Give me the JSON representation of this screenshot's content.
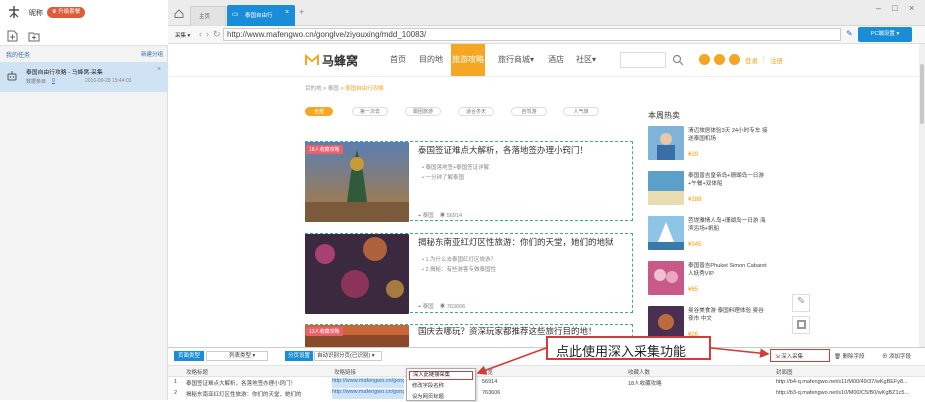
{
  "app": {
    "username": "昵称",
    "upgrade": "升级套餐",
    "my_tasks": "我的任务",
    "create_group": "新建分组",
    "task": {
      "title": "泰国自由行攻略 - 马蜂窝-采集",
      "count_label": "数据条目",
      "count": "0",
      "time": "2016-09-28 15:44:03"
    }
  },
  "browser": {
    "tabs": [
      {
        "label": "主页"
      },
      {
        "label": "泰国自由行"
      }
    ],
    "new_tab": "+",
    "collect_mode": "采集",
    "url": "http://www.mafengwo.cn/gonglve/ziyouxing/mdd_10083/",
    "pc_button": "PC端设置"
  },
  "site": {
    "logo": "马蜂窝",
    "nav": [
      "首页",
      "目的地",
      "旅游攻略",
      "旅行商城",
      "酒店",
      "社区"
    ],
    "login": "登录",
    "register": "注册",
    "breadcrumb": [
      "目的地",
      "泰国",
      "泰国自由行攻略"
    ],
    "filters": [
      "全部",
      "第一次去",
      "跟团旅游",
      "适合冬天",
      "自驾游",
      "人气旅"
    ],
    "articles": [
      {
        "title": "泰国签证难点大解析，各落地签办理小窍门！",
        "badge": "18人收藏攻略",
        "bullets": [
          "泰国落地签+泰国签证详解",
          "一分钟了解泰国"
        ],
        "place": "泰国",
        "views": "56914"
      },
      {
        "title": "揭秘东南亚红灯区性旅游：你们的天堂，她们的地狱",
        "badge": "",
        "bullets": [
          "1.为什么去泰国红灯区旅游？",
          "2.揭秘：有些游客专做泰国性"
        ],
        "place": "泰国",
        "views": "763606"
      },
      {
        "title": "国庆去哪玩？资深玩家都推荐这些旅行目的地！",
        "badge": "13人收藏攻略",
        "bullets": [],
        "place": "",
        "views": ""
      }
    ],
    "hot_title": "本周热卖",
    "hot": [
      {
        "text": "清迈旅居体验3天 24小时专车 接送泰国机场",
        "price": "¥39"
      },
      {
        "text": "泰国普吉皇帝岛+珊瑚岛一日游+午餐+双体船",
        "price": "¥288"
      },
      {
        "text": "芭堤雅情人岛+珊瑚岛一日游 海滨浴场+帆船",
        "price": "¥345"
      },
      {
        "text": "泰国普吉Phuket Simon Cabaret人妖秀VIP",
        "price": "¥65"
      },
      {
        "text": "曼谷美食游 泰国料理体验 曼谷夜市 中文",
        "price": "¥26"
      }
    ]
  },
  "bottom": {
    "btn1": "页面类型",
    "type_label": "列表类型",
    "btn2": "分页设置",
    "page_label": "自动识别分页(已识别)",
    "deep_collect": "深入采集",
    "delete_field": "删除字段",
    "add_field": "添加字段",
    "annotation": "点此使用深入采集功能",
    "dropdown": [
      "深入此链接采集",
      "修改字段名称",
      "设为网页标题"
    ],
    "columns": [
      "攻略标题",
      "攻略链接",
      "浏览",
      "收藏人数",
      "封面图"
    ],
    "rows": [
      {
        "n": "1",
        "title": "泰国签证难点大解析，各落地签办理小窍门！",
        "link": "http://www.mafengwo.cn/gonglve/ziyouxing/",
        "views": "56914",
        "fav": "18人收藏攻略",
        "img": "http://b4-q.mafengwo.net/s11/M00/49/37/wKgBEFy8..."
      },
      {
        "n": "2",
        "title": "揭秘东南亚红灯区性旅游：你们的天堂，她们的",
        "link": "http://www.mafengwo.cn/gonglve/ziyouxing/",
        "views": "763606",
        "fav": "",
        "img": "http://b3-q.mafengwo.net/s10/M00/C5/B0/wKgBZ1c5..."
      }
    ]
  }
}
